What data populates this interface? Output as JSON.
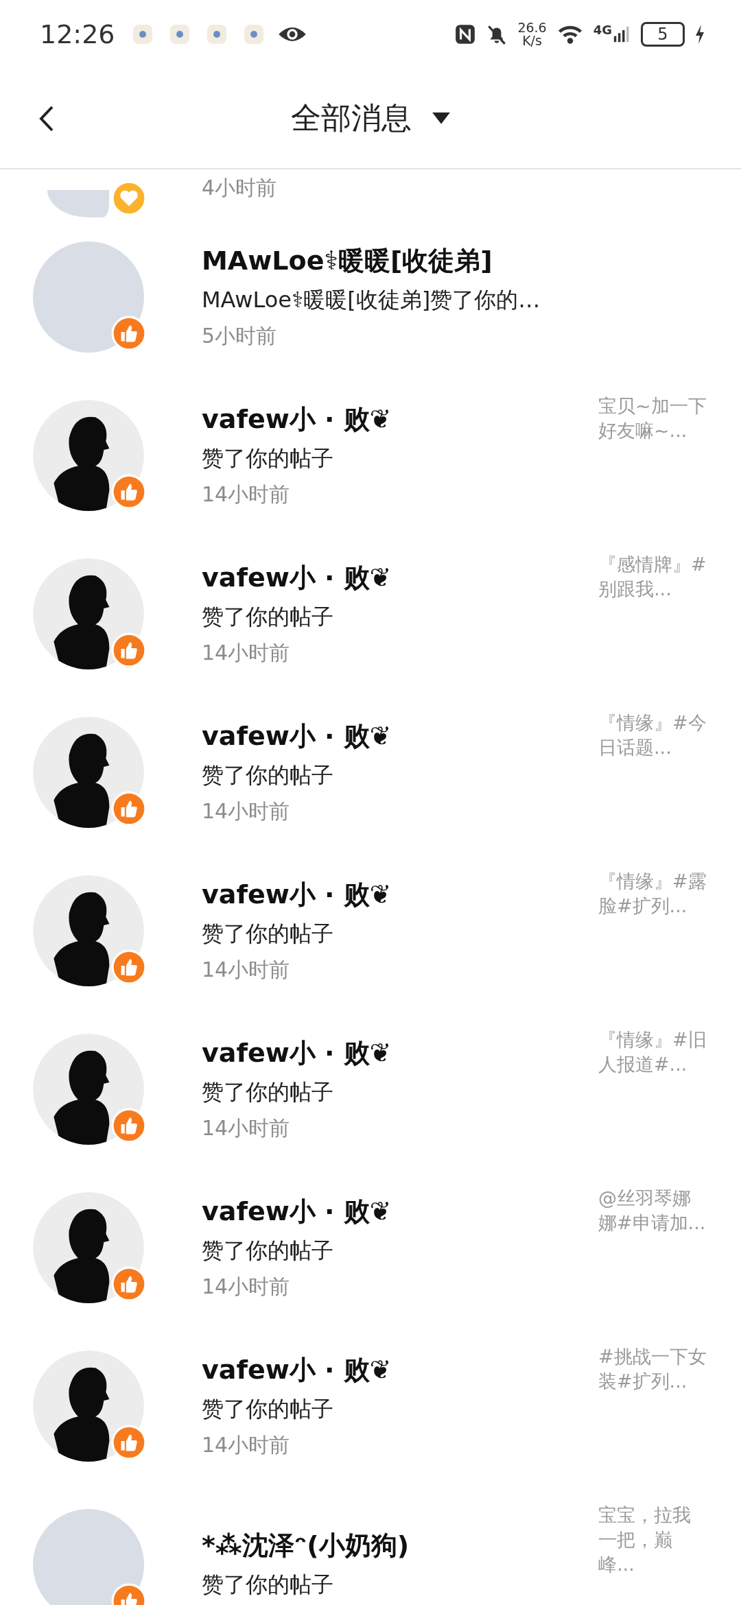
{
  "status_bar": {
    "time": "12:26",
    "speed_value": "26.6",
    "speed_unit": "K/s",
    "network": "4G",
    "battery": "5"
  },
  "header": {
    "title": "全部消息"
  },
  "messages": [
    {
      "avatar": {
        "kind": "photo"
      },
      "badge": {
        "kind": "heart"
      },
      "time": "4小时前"
    },
    {
      "avatar": {
        "kind": "photo"
      },
      "badge": {
        "kind": "like"
      },
      "name": "MAwLoe⚕暖暖[收徒弟]",
      "text": "MAwLoe⚕暖暖[收徒弟]赞了你的…",
      "time": "5小时前"
    },
    {
      "avatar": {
        "kind": "silhouette"
      },
      "badge": {
        "kind": "like"
      },
      "name": "vafew小 · 败❦",
      "text": "赞了你的帖子",
      "time": "14小时前",
      "snippet": "宝贝~加一下好友嘛~..."
    },
    {
      "avatar": {
        "kind": "silhouette"
      },
      "badge": {
        "kind": "like"
      },
      "name": "vafew小 · 败❦",
      "text": "赞了你的帖子",
      "time": "14小时前",
      "snippet": "『感情牌』#别跟我..."
    },
    {
      "avatar": {
        "kind": "silhouette"
      },
      "badge": {
        "kind": "like"
      },
      "name": "vafew小 · 败❦",
      "text": "赞了你的帖子",
      "time": "14小时前",
      "snippet": "『情缘』#今日话题..."
    },
    {
      "avatar": {
        "kind": "silhouette"
      },
      "badge": {
        "kind": "like"
      },
      "name": "vafew小 · 败❦",
      "text": "赞了你的帖子",
      "time": "14小时前",
      "snippet": "『情缘』#露脸#扩列..."
    },
    {
      "avatar": {
        "kind": "silhouette"
      },
      "badge": {
        "kind": "like"
      },
      "name": "vafew小 · 败❦",
      "text": "赞了你的帖子",
      "time": "14小时前",
      "snippet": "『情缘』#旧人报道#..."
    },
    {
      "avatar": {
        "kind": "silhouette"
      },
      "badge": {
        "kind": "like"
      },
      "name": "vafew小 · 败❦",
      "text": "赞了你的帖子",
      "time": "14小时前",
      "snippet": "@丝羽琴娜娜#申请加..."
    },
    {
      "avatar": {
        "kind": "silhouette"
      },
      "badge": {
        "kind": "like"
      },
      "name": "vafew小 · 败❦",
      "text": "赞了你的帖子",
      "time": "14小时前",
      "snippet": "#挑战一下女装#扩列..."
    },
    {
      "avatar": {
        "kind": "photo"
      },
      "badge": {
        "kind": "like"
      },
      "name": "*⁂沈泽ᵔ(小奶狗)",
      "text": "赞了你的帖子",
      "snippet": "宝宝，拉我一把，巅峰..."
    }
  ]
}
